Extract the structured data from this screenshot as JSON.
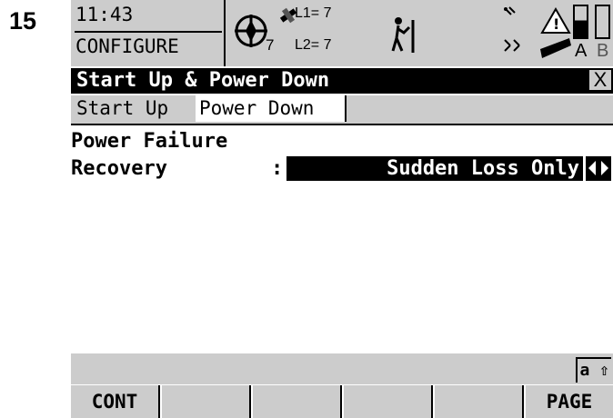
{
  "step_number": "15",
  "status": {
    "time": "11:43",
    "program": "CONFIGURE",
    "satellites_visible": "7",
    "l1": "L1= 7",
    "l2": "L2= 7",
    "battery_a_label": "A",
    "battery_b_label": "B",
    "battery_a_level": 0.55
  },
  "title": "Start Up & Power Down",
  "close_glyph": "X",
  "tabs": [
    {
      "label": "Start Up",
      "active": false
    },
    {
      "label": "Power Down",
      "active": true
    }
  ],
  "fields": {
    "line1": "Power Failure",
    "line2": "Recovery",
    "colon": ":",
    "value": "Sudden Loss Only"
  },
  "input_mode": "a ⇧",
  "softkeys": [
    "CONT",
    "",
    "",
    "",
    "",
    "PAGE"
  ]
}
